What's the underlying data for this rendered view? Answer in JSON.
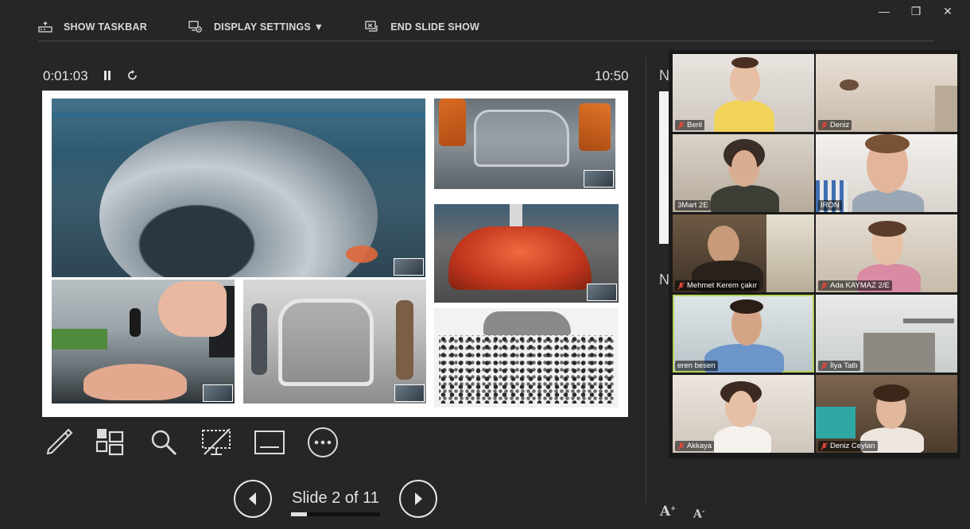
{
  "window": {
    "minimize": "—",
    "restore": "❐",
    "close": "✕"
  },
  "toolbar": {
    "show_taskbar": "SHOW TASKBAR",
    "display_settings": "DISPLAY SETTINGS ▼",
    "end_slide_show": "END SLIDE SHOW"
  },
  "presenter": {
    "timer": "0:01:03",
    "clock": "10:50"
  },
  "navigation": {
    "slide_label": "Slide 2 of 11",
    "current": 2,
    "total": 11,
    "progress": 0.18
  },
  "notes": {
    "heading1": "N",
    "heading2": "N"
  },
  "font_controls": {
    "increase": "A",
    "decrease": "A"
  },
  "participants": [
    {
      "name": "Beril",
      "muted": true
    },
    {
      "name": "Deniz",
      "muted": true
    },
    {
      "name": "3Mart 2E",
      "muted": false
    },
    {
      "name": "IRON",
      "muted": false
    },
    {
      "name": "Mehmet Kerem çakır",
      "muted": true
    },
    {
      "name": "Ada KAYMAZ 2/E",
      "muted": true
    },
    {
      "name": "eren besen",
      "muted": false,
      "active": true
    },
    {
      "name": "İlya Tatlı",
      "muted": true
    },
    {
      "name": "Akkaya",
      "muted": true
    },
    {
      "name": "Deniz Ceylan",
      "muted": true
    }
  ],
  "colors": {
    "background": "#262626",
    "active_speaker": "#b6d35a",
    "mic_off": "#e0463a"
  }
}
